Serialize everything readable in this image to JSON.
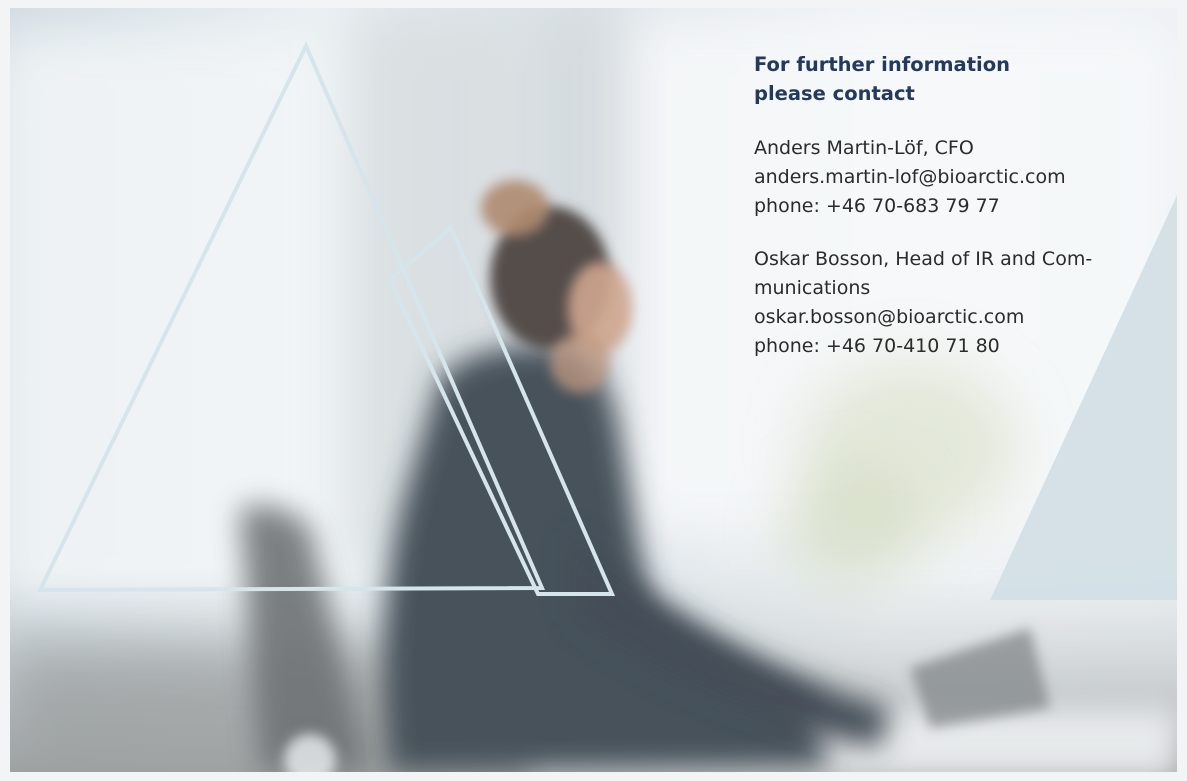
{
  "contact": {
    "heading_line1": "For further information",
    "heading_line2": "please contact",
    "people": [
      {
        "name_title_line1": "Anders Martin-Löf, CFO",
        "email": "anders.martin-lof@bioarctic.com",
        "phone": "phone: +46 70-683 79 77"
      },
      {
        "name_title_line1": "Oskar Bosson, Head of IR and Com-",
        "name_title_line2": "munications",
        "email": "oskar.bosson@bioarctic.com",
        "phone": "phone: +46 70-410 71 80"
      }
    ]
  },
  "colors": {
    "heading": "#233a5e",
    "body_text": "#2b2b2b",
    "triangle_outline": "#d6e4ec",
    "triangle_fill": "#d3dfe6"
  },
  "background_image": {
    "kind": "blurred office photo of a person at a desk with triangle logo outlines"
  }
}
